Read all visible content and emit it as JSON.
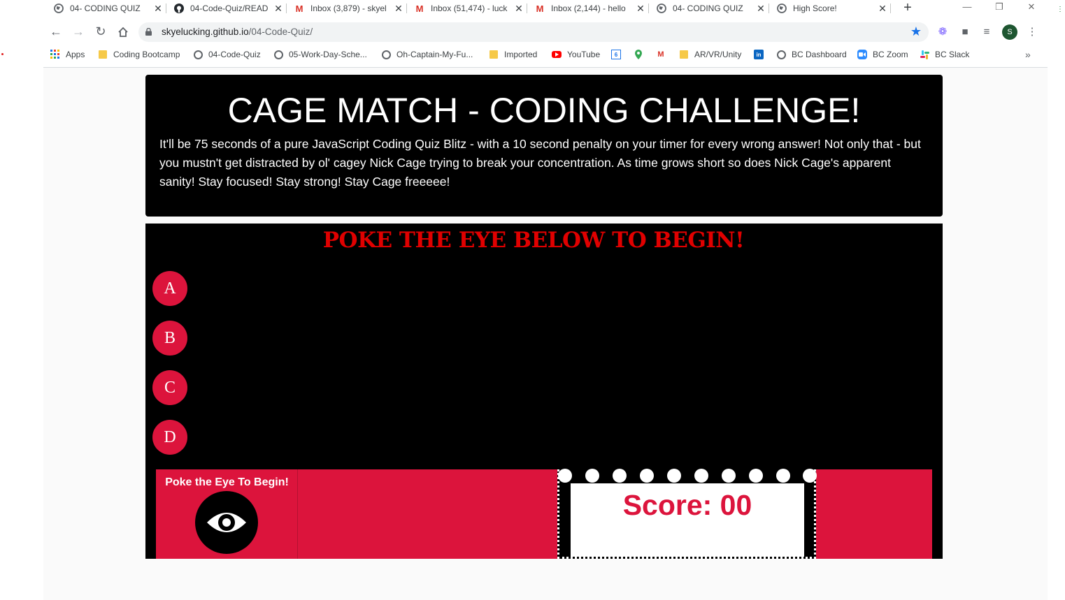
{
  "browser": {
    "tabs": [
      {
        "title": "04- CODING QUIZ",
        "favicon": "globe-icon",
        "active": true
      },
      {
        "title": "04-Code-Quiz/READ",
        "favicon": "github-icon",
        "active": false
      },
      {
        "title": "Inbox (3,879) - skyel",
        "favicon": "gmail-icon",
        "active": false
      },
      {
        "title": "Inbox (51,474) - luck",
        "favicon": "gmail-icon",
        "active": false
      },
      {
        "title": "Inbox (2,144) - hello",
        "favicon": "gmail-icon",
        "active": false
      },
      {
        "title": "04- CODING QUIZ",
        "favicon": "globe-icon",
        "active": false
      },
      {
        "title": "High Score!",
        "favicon": "globe-icon",
        "active": false
      }
    ],
    "close_glyph": "✕",
    "new_tab_glyph": "+",
    "url_host": "skyelucking.github.io",
    "url_path": "/04-Code-Quiz/",
    "profile_initial": "S",
    "bookmarks": [
      {
        "label": "Apps",
        "icon": "apps-grid-icon"
      },
      {
        "label": "Coding Bootcamp",
        "icon": "folder-icon"
      },
      {
        "label": "04-Code-Quiz",
        "icon": "globe-icon"
      },
      {
        "label": "05-Work-Day-Sche...",
        "icon": "globe-icon"
      },
      {
        "label": "Oh-Captain-My-Fu...",
        "icon": "globe-icon"
      },
      {
        "label": "Imported",
        "icon": "folder-icon"
      },
      {
        "label": "YouTube",
        "icon": "youtube-icon"
      },
      {
        "label": "",
        "icon": "calendar-icon"
      },
      {
        "label": "",
        "icon": "maps-pin-icon"
      },
      {
        "label": "",
        "icon": "gmail-icon"
      },
      {
        "label": "AR/VR/Unity",
        "icon": "folder-icon"
      },
      {
        "label": "",
        "icon": "linkedin-icon"
      },
      {
        "label": "BC Dashboard",
        "icon": "globe-icon"
      },
      {
        "label": "BC Zoom",
        "icon": "zoom-icon"
      },
      {
        "label": "BC Slack",
        "icon": "slack-icon"
      }
    ],
    "bookmarks_more": "»"
  },
  "page": {
    "title": "CAGE MATCH - CODING CHALLENGE!",
    "intro": "It'll be 75 seconds of a pure JavaScript Coding Quiz Blitz - with a 10 second penalty on your timer for every wrong answer! Not only that - but you mustn't get distracted by ol' cagey Nick Cage trying to break your concentration. As time grows short so does Nick Cage's apparent sanity! Stay focused! Stay strong! Stay Cage freeeee!",
    "question": "POKE THE EYE BELOW TO BEGIN!",
    "answers": [
      "A",
      "B",
      "C",
      "D"
    ],
    "start_label": "Poke the Eye To Begin!",
    "score_text": "Score: 00",
    "colors": {
      "accent": "#dc143c",
      "question": "#e00000",
      "card": "#000000"
    }
  }
}
